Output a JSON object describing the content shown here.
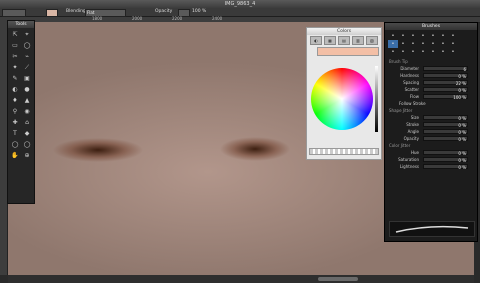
{
  "window": {
    "title": "IMG_9863_4"
  },
  "toolbar": {
    "mode_value": "",
    "blending_label": "Blending",
    "blending_value": "Flat",
    "opacity_label": "Opacity",
    "opacity_value": "100 %"
  },
  "ruler": {
    "labels": [
      "",
      "1800",
      "2000",
      "2200",
      "2400",
      "",
      "",
      "",
      "",
      "",
      ""
    ]
  },
  "tools": {
    "title": "Tools",
    "icons": [
      "⇱",
      "⌖",
      "▭",
      "◯",
      "✂",
      "⌁",
      "✦",
      "⟋",
      "✎",
      "▣",
      "◐",
      "●",
      "♦",
      "▲",
      "⚲",
      "◉",
      "✚",
      "⌂",
      "T",
      "◆",
      "◯",
      "◯",
      "✋",
      "⊕"
    ]
  },
  "colors": {
    "title": "Colors",
    "tabs": [
      "◐",
      "▦",
      "▤",
      "▥",
      "▧"
    ],
    "accent": "#f3bfa6"
  },
  "brushes": {
    "title": "Brushes",
    "grid": [
      "•",
      "•",
      "•",
      "•",
      "•",
      "•",
      "•",
      "•",
      "•",
      "•",
      "•",
      "•",
      "•",
      "•",
      "•",
      "•",
      "•",
      "•",
      "•",
      "•",
      "•"
    ],
    "brush_tip": "Brush Tip",
    "tip_rows": [
      {
        "k": "Diameter",
        "v": "6"
      },
      {
        "k": "Hardness",
        "v": "0 %"
      },
      {
        "k": "Spacing",
        "v": "22 %"
      },
      {
        "k": "Scatter",
        "v": "0 %"
      },
      {
        "k": "Flow",
        "v": "100 %"
      }
    ],
    "follow_stroke": "Follow Stroke",
    "shape_jitter": "Shape Jitter",
    "shape_rows": [
      {
        "k": "Size",
        "v": "0 %"
      },
      {
        "k": "Stroke",
        "v": "0 %"
      },
      {
        "k": "Angle",
        "v": "0 %"
      },
      {
        "k": "Opacity",
        "v": "0 %"
      }
    ],
    "color_jitter": "Color Jitter",
    "color_rows": [
      {
        "k": "Hue",
        "v": "0 %"
      },
      {
        "k": "Saturation",
        "v": "0 %"
      },
      {
        "k": "Lightness",
        "v": "0 %"
      }
    ]
  }
}
